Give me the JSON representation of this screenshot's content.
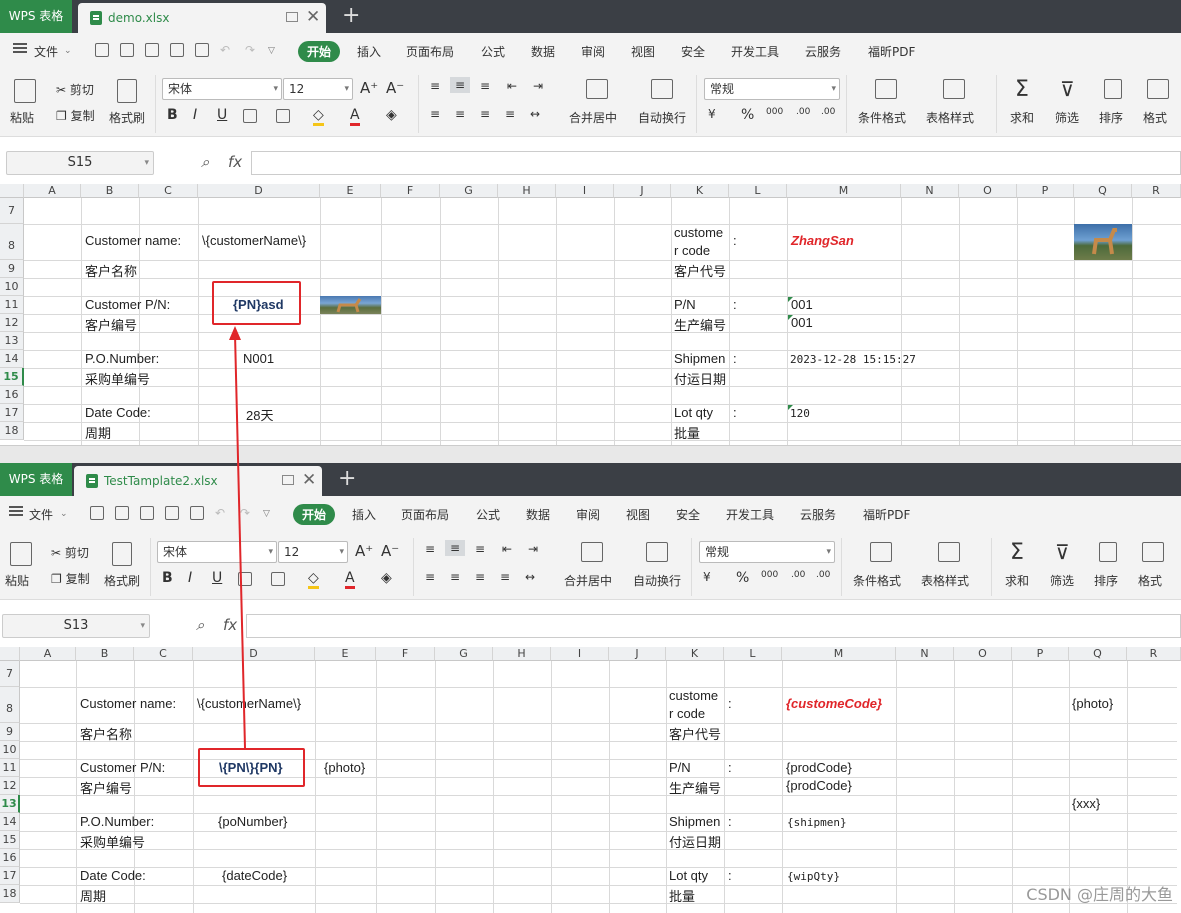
{
  "app": {
    "brand": "WPS 表格",
    "new_tab": "+"
  },
  "top": {
    "file_tab": "demo.xlsx",
    "cell_ref": "S15",
    "selected_row": "15",
    "cells": {
      "customer_name_label": "Customer name:",
      "customer_name_value": "\\{customerName\\}",
      "customer_name_cn": "客户名称",
      "customer_code_label_1": "custome",
      "customer_code_label_2": "r code",
      "customer_code_colon": ":",
      "customer_code_value": "ZhangSan",
      "customer_code_cn": "客户代号",
      "customer_pn_label": "Customer P/N:",
      "customer_pn_value": "{PN}asd",
      "customer_pn_cn": "客户编号",
      "pn_label": "P/N",
      "pn_colon": ":",
      "pn_value": "001",
      "prod_cn": "生产编号",
      "prod_value": "001",
      "po_label": "P.O.Number:",
      "po_value": "N001",
      "po_cn": "采购单编号",
      "ship_label": "Shipmen",
      "ship_colon": ":",
      "ship_value": "2023-12-28 15:15:27",
      "ship_cn": "付运日期",
      "date_label": "Date Code:",
      "date_value": "28天",
      "date_cn": "周期",
      "lot_label": "Lot qty",
      "lot_colon": ":",
      "lot_value": "120",
      "lot_cn": "批量"
    }
  },
  "bottom": {
    "file_tab": "TestTamplate2.xlsx",
    "cell_ref": "S13",
    "selected_row": "13",
    "cells": {
      "customer_name_label": "Customer name:",
      "customer_name_value": "\\{customerName\\}",
      "customer_name_cn": "客户名称",
      "customer_code_label_1": "custome",
      "customer_code_label_2": "r code",
      "customer_code_colon": ":",
      "customer_code_value": "{customeCode}",
      "customer_code_cn": "客户代号",
      "photo_top": "{photo}",
      "customer_pn_label": "Customer P/N:",
      "customer_pn_value": "\\{PN\\}{PN}",
      "photo_mid": "{photo}",
      "customer_pn_cn": "客户编号",
      "pn_label": "P/N",
      "pn_colon": ":",
      "pn_value": "{prodCode}",
      "prod_cn": "生产编号",
      "prod_value": "{prodCode}",
      "xxx": "{xxx}",
      "po_label": "P.O.Number:",
      "po_value": "{poNumber}",
      "po_cn": "采购单编号",
      "ship_label": "Shipmen",
      "ship_colon": ":",
      "ship_value": "{shipmen}",
      "ship_cn": "付运日期",
      "date_label": "Date Code:",
      "date_value": "{dateCode}",
      "date_cn": "周期",
      "lot_label": "Lot qty",
      "lot_colon": ":",
      "lot_value": "{wipQty}",
      "lot_cn": "批量"
    }
  },
  "menu": [
    "开始",
    "插入",
    "页面布局",
    "公式",
    "数据",
    "审阅",
    "视图",
    "安全",
    "开发工具",
    "云服务",
    "福昕PDF"
  ],
  "file_menu": "文件",
  "toolbar": {
    "paste": "粘贴",
    "cut": "剪切",
    "copy": "复制",
    "format_painter": "格式刷",
    "font": "宋体",
    "size": "12",
    "bold": "B",
    "italic": "I",
    "underline": "U",
    "merge": "合并居中",
    "wrap": "自动换行",
    "number_format": "常规",
    "currency": "¥",
    "percent": "%",
    "thousands": "000",
    "inc_dec": ".00",
    "cond_format": "条件格式",
    "table_style": "表格样式",
    "sum": "求和",
    "filter": "筛选",
    "sort": "排序",
    "fmt": "格式"
  },
  "columns": [
    "A",
    "B",
    "C",
    "D",
    "E",
    "F",
    "G",
    "H",
    "I",
    "J",
    "K",
    "L",
    "M",
    "N",
    "O",
    "P",
    "Q",
    "R"
  ],
  "rows": [
    "7",
    "8",
    "9",
    "10",
    "11",
    "12",
    "13",
    "14",
    "15",
    "16",
    "17",
    "18"
  ],
  "watermark": "CSDN @庄周的大鱼",
  "colors": {
    "brand_green": "#2f8b4a",
    "highlight_red": "#e0262a",
    "dark_blue": "#1f3864"
  }
}
